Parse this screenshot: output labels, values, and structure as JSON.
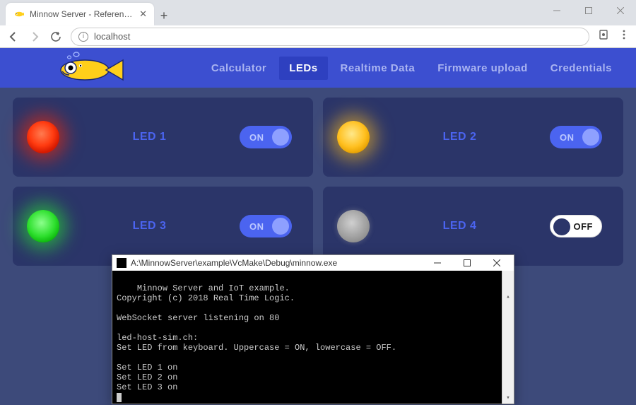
{
  "browser": {
    "tab_title": "Minnow Server - Reference Platf",
    "url": "localhost"
  },
  "nav": {
    "items": [
      "Calculator",
      "LEDs",
      "Realtime Data",
      "Firmware upload",
      "Credentials"
    ],
    "active_index": 1
  },
  "leds": [
    {
      "label": "LED 1",
      "color": "red",
      "on": true,
      "toggle_label": "ON"
    },
    {
      "label": "LED 2",
      "color": "amber",
      "on": true,
      "toggle_label": "ON"
    },
    {
      "label": "LED 3",
      "color": "green",
      "on": true,
      "toggle_label": "ON"
    },
    {
      "label": "LED 4",
      "color": "off",
      "on": false,
      "toggle_label": "OFF"
    }
  ],
  "console": {
    "title": "A:\\MinnowServer\\example\\VcMake\\Debug\\minnow.exe",
    "lines": [
      "Minnow Server and IoT example.",
      "Copyright (c) 2018 Real Time Logic.",
      "",
      "WebSocket server listening on 80",
      "",
      "led-host-sim.ch:",
      "Set LED from keyboard. Uppercase = ON, lowercase = OFF.",
      "",
      "Set LED 1 on",
      "Set LED 2 on",
      "Set LED 3 on"
    ]
  },
  "colors": {
    "navbar": "#3c4fd0",
    "card": "#2b3569",
    "accent": "#4b64f0"
  }
}
